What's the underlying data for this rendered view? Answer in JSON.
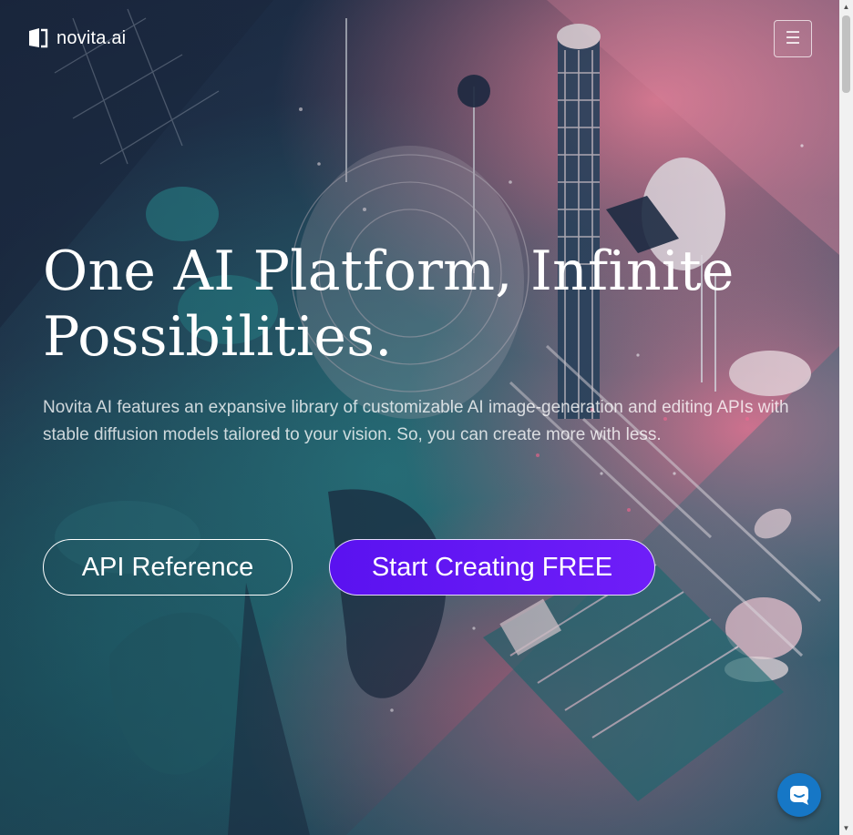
{
  "brand": {
    "name": "novita.ai",
    "logo_icon": "novita-logo-icon"
  },
  "nav": {
    "menu_icon": "hamburger-menu-icon",
    "menu_glyph": "☰"
  },
  "hero": {
    "title": "One AI Platform, Infinite Possibilities.",
    "description": "Novita AI features an expansive library of customizable AI image-generation and editing APIs with stable diffusion models tailored to your vision. So, you can create more with less."
  },
  "actions": {
    "api_reference": "API Reference",
    "start_creating": "Start Creating FREE"
  },
  "chat": {
    "icon": "chat-bubble-icon"
  },
  "colors": {
    "primary_button": "#5a12f0",
    "chat_button": "#1677c6",
    "text": "#ffffff"
  }
}
